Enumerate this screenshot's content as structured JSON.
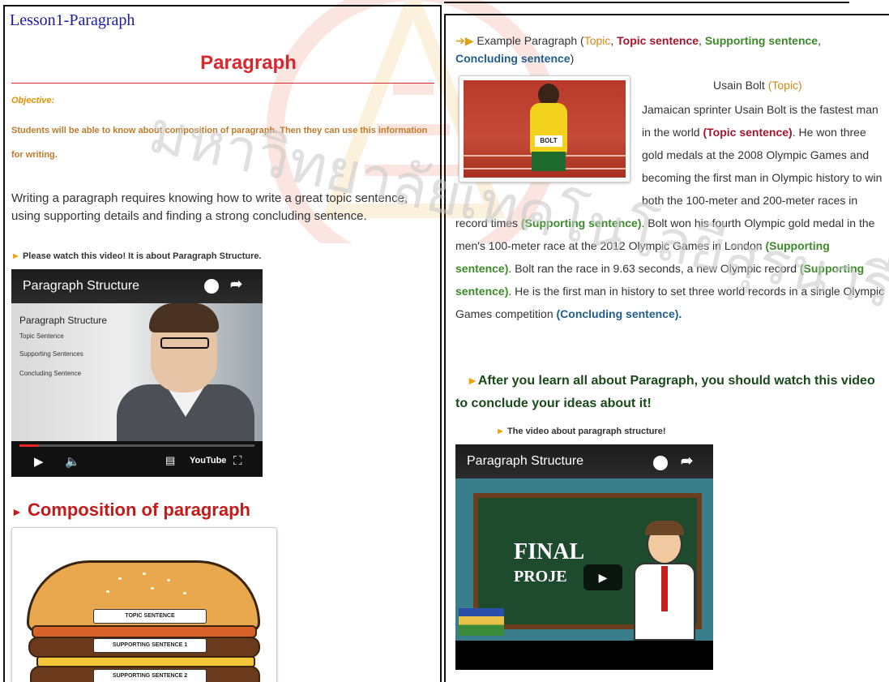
{
  "watermark": {
    "seal_colors": [
      "#f2b6a8",
      "#f6d9a0"
    ],
    "text": "มหาวิทยาลัยเทคโนโลยีสุรนารี"
  },
  "left": {
    "lesson_title": "Lesson1-Paragraph",
    "page_title": "Paragraph",
    "objective_label": "Objective:",
    "objective_text": "Students will be able to know about composition of paragraph. Then they can use this information for writing.",
    "intro": "Writing a paragraph requires knowing how to write a great topic sentence, using supporting details and finding a strong concluding sentence.",
    "watch_note": "Please watch this video! It is about Paragraph Structure.",
    "video": {
      "title": "Paragraph Structure",
      "slide_heading": "Paragraph Structure",
      "slide_items": [
        "Topic Sentence",
        "Supporting Sentences",
        "Concluding Sentence"
      ],
      "progress": 0.08,
      "brand": "YouTube"
    },
    "composition_title": "Composition of paragraph",
    "burger_labels": [
      "TOPIC SENTENCE",
      "SUPPORTING SENTENCE 1",
      "SUPPORTING SENTENCE 2"
    ]
  },
  "right": {
    "example_intro": "Example Paragraph (",
    "legend": {
      "topic": "Topic",
      "topic_sentence": "Topic sentence",
      "supporting": "Supporting sentence",
      "concluding": "Concluding sentence"
    },
    "usain_title": "Usain Bolt",
    "topic_tag": "(Topic)",
    "bib": "BOLT",
    "p1": "Jamaican sprinter Usain Bolt is the fastest man in the world ",
    "t1": "(Topic sentence)",
    "p2": ". He won three gold medals at the 2008 Olympic Games and becoming the first man in Olympic history to win both the 100-meter and 200-meter races in record times ",
    "s1": "(Supporting sentence)",
    "p3": ". Bolt won his fourth Olympic gold medal in the men's 100-meter race at the 2012 Olympic Games in London ",
    "s2": "(Supporting sentence)",
    "p4": ". Bolt ran the race in 9.63 seconds, a new Olympic record ",
    "s3": "(Supporting sentence)",
    "p5": ". He is the first man in history to set three world records in a single Olympic Games competition ",
    "c1": "(Concluding sentence).",
    "after_title": "After you learn all about Paragraph, you should watch this video to conclude your ideas about it!",
    "video_note": "The video about paragraph structure!",
    "video": {
      "title": "Paragraph Structure",
      "board_line1": "FINAL",
      "board_line2": "PROJE"
    }
  }
}
